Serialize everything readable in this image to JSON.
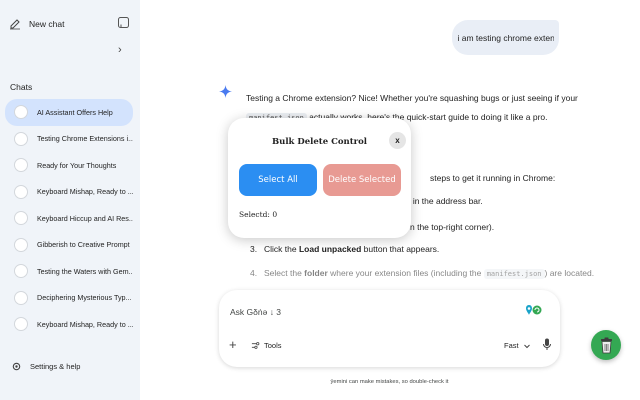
{
  "sidebar": {
    "new_chat": "New chat",
    "chats_title": "Chats",
    "chats": [
      {
        "label": "AI Assistant Offers Help",
        "active": true
      },
      {
        "label": "Testing Chrome Extensions i...",
        "active": false
      },
      {
        "label": "Ready for Your Thoughts",
        "active": false
      },
      {
        "label": "Keyboard Mishap, Ready to ...",
        "active": false
      },
      {
        "label": "Keyboard Hiccup and AI Res...",
        "active": false
      },
      {
        "label": "Gibberish to Creative Prompt",
        "active": false
      },
      {
        "label": "Testing the Waters with Gem...",
        "active": false
      },
      {
        "label": "Deciphering Mysterious Typ...",
        "active": false
      },
      {
        "label": "Keyboard Mishap, Ready to ...",
        "active": false
      }
    ],
    "settings": "Settings & help"
  },
  "conversation": {
    "user_message": "i am testing chrome extensio",
    "response_intro": "Testing a Chrome extension? Nice! Whether you're squashing bugs or just seeing if your",
    "response_code1": "manifest.json",
    "response_line2_rest": "actually works, here's the quick-start guide to doing it like a pro.",
    "steps_intro_tail": "steps to get it running in Chrome:",
    "step1_code": "s/",
    "step1_tail": "in the address bar.",
    "step2_tail": "n the top-right corner).",
    "step3_num": "3.",
    "step3_pre": "Click the ",
    "step3_bold": "Load unpacked",
    "step3_post": " button that appears.",
    "step4_num": "4.",
    "step4_pre": "Select the ",
    "step4_bold": "folder",
    "step4_mid": " where your extension files (including the ",
    "step4_code": "manifest.json",
    "step4_post": ") are located."
  },
  "composer": {
    "placeholder": "Ask Gδṅə ↓ 3",
    "tools_label": "Tools",
    "mode_label": "Fast",
    "disclaimer": "ȳemini can make mistakes, so double-check it"
  },
  "modal": {
    "title": "Bulk Delete Control",
    "close_label": "x",
    "select_all": "Select All",
    "delete_selected": "Delete Selected",
    "selected_count": "Selectd: 0"
  },
  "colors": {
    "sidebar_bg": "#f0f4f9",
    "active_chat": "#d3e3fd",
    "select_all_btn": "#2b8ef2",
    "delete_btn": "#e89a93",
    "trash_fab": "#34a853"
  },
  "icons": {
    "new_chat": "edit-icon",
    "sidebar_toggle": "panel-icon",
    "spark": "gemini-spark-icon",
    "settings": "gear-icon",
    "tools": "tools-icon",
    "mic": "mic-icon",
    "trash": "trash-icon"
  }
}
